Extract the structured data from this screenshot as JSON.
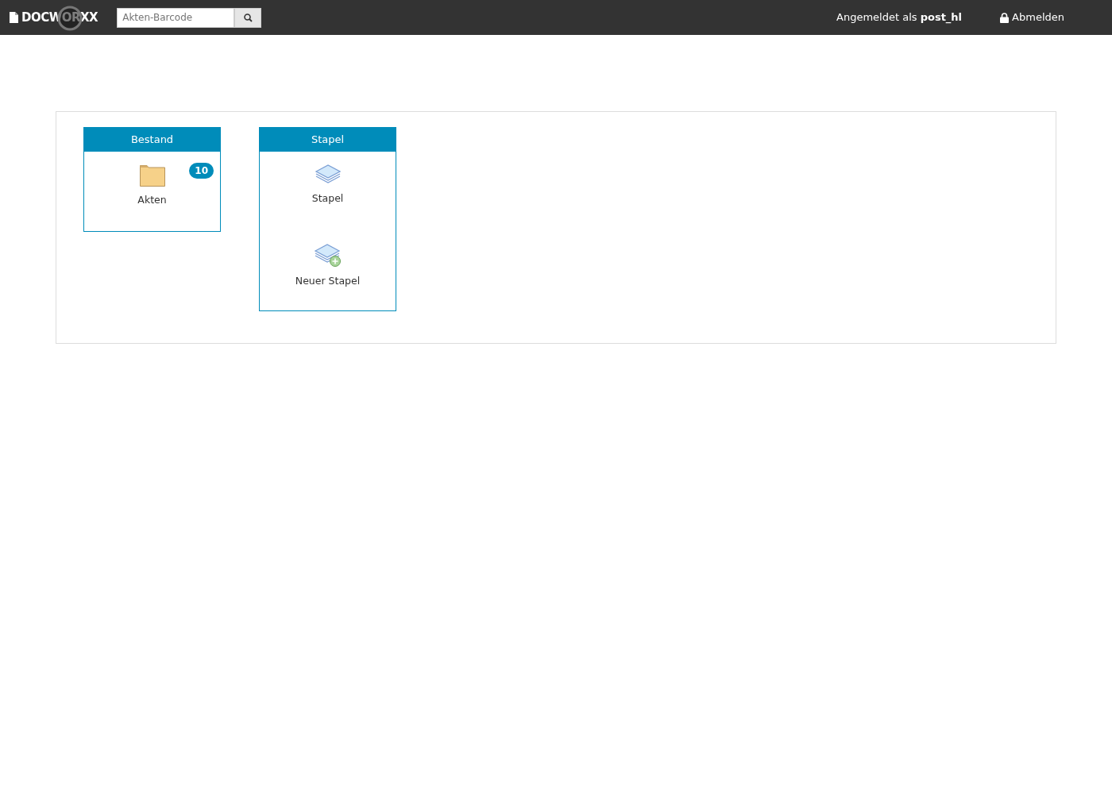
{
  "navbar": {
    "brand": "DOCWORXX",
    "search": {
      "placeholder": "Akten-Barcode"
    },
    "loading": true,
    "user_prefix": "Angemeldet als",
    "user": "post_hl",
    "logout": "Abmelden"
  },
  "tiles": [
    {
      "title": "Bestand",
      "items": [
        {
          "kind": "folder",
          "label": "Akten",
          "badge": "10"
        }
      ]
    },
    {
      "title": "Stapel",
      "items": [
        {
          "kind": "stack",
          "label": "Stapel"
        },
        {
          "kind": "stack-add",
          "label": "Neuer Stapel"
        }
      ]
    }
  ]
}
